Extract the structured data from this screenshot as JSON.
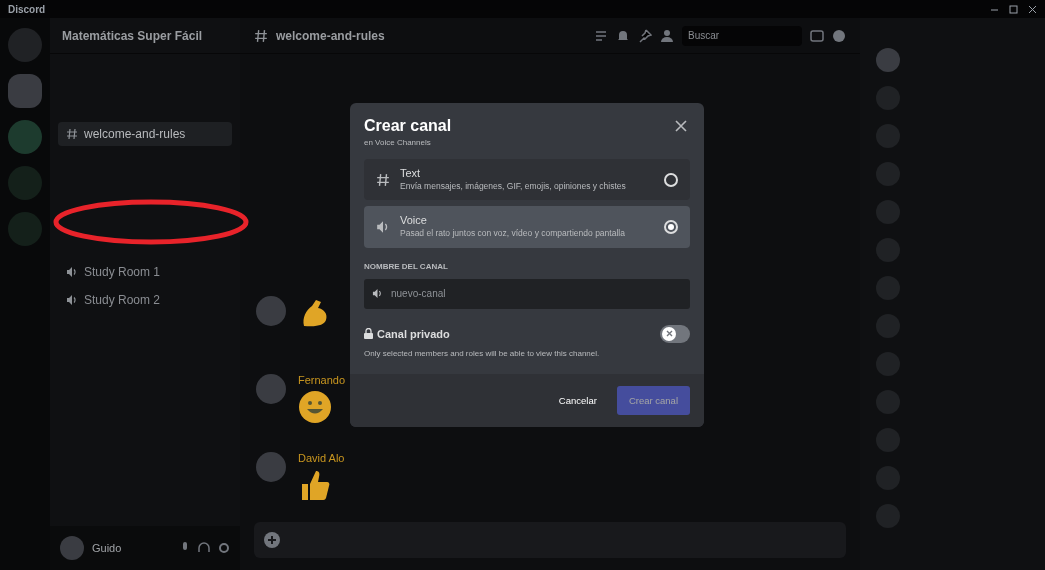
{
  "window": {
    "title": "Discord"
  },
  "server": {
    "name": "Matemáticas Super Fácil"
  },
  "header": {
    "channel": "welcome-and-rules",
    "search_placeholder": "Buscar"
  },
  "channels": [
    {
      "name": "welcome-and-rules",
      "kind": "text",
      "selected": true
    },
    {
      "name": "Study Room 1",
      "kind": "voice",
      "selected": false
    },
    {
      "name": "Study Room 2",
      "kind": "voice",
      "selected": false
    }
  ],
  "messages": [
    {
      "kind": "arm"
    },
    {
      "author": "Fernando",
      "kind": "smile"
    },
    {
      "author": "David Alo",
      "kind": "thumb"
    }
  ],
  "user": {
    "name": "Guido"
  },
  "dialog": {
    "title": "Crear canal",
    "subtitle": "en Voice Channels",
    "types": [
      {
        "kind": "text",
        "label": "Text",
        "description": "Envía mensajes, imágenes, GIF, emojis, opiniones y chistes",
        "selected": false
      },
      {
        "kind": "voice",
        "label": "Voice",
        "description": "Pasad el rato juntos con voz, vídeo y compartiendo pantalla",
        "selected": true
      }
    ],
    "name_label": "NOMBRE DEL CANAL",
    "name_placeholder": "nuevo-canal",
    "private": {
      "label": "Canal privado",
      "on": false,
      "hint": "Only selected members and roles will be able to view this channel."
    },
    "cancel": "Cancelar",
    "create": {
      "label": "Crear canal",
      "disabled": true
    }
  }
}
